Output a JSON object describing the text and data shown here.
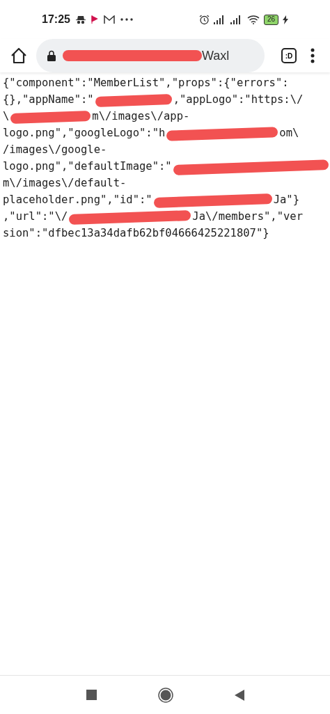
{
  "status_bar": {
    "time": "17:25",
    "battery": "26"
  },
  "address_bar": {
    "url": [
      {
        "kind": "redacted"
      },
      {
        "kind": "text",
        "text": "Waxl"
      }
    ]
  },
  "tab_count": ":D",
  "lines": [
    {
      "segments": [
        {
          "kind": "text",
          "text": "{\"component\":\"MemberList\",\"props\":{\"errors\":"
        }
      ]
    },
    {
      "segments": [
        {
          "kind": "text",
          "text": "{},\"appName\":\""
        },
        {
          "kind": "redacted"
        },
        {
          "kind": "text",
          "text": ",\"appLogo\":\"https:\\/"
        }
      ]
    },
    {
      "segments": [
        {
          "kind": "text",
          "text": "\\"
        },
        {
          "kind": "redacted"
        },
        {
          "kind": "text",
          "text": "m\\/images\\/app-"
        }
      ]
    },
    {
      "segments": [
        {
          "kind": "text",
          "text": "logo.png\",\"googleLogo\":\"h"
        },
        {
          "kind": "redacted"
        },
        {
          "kind": "text",
          "text": "om\\"
        }
      ]
    },
    {
      "segments": [
        {
          "kind": "text",
          "text": "/images\\/google-"
        }
      ]
    },
    {
      "segments": [
        {
          "kind": "text",
          "text": "logo.png\",\"defaultImage\":\""
        },
        {
          "kind": "redacted"
        }
      ]
    },
    {
      "segments": [
        {
          "kind": "text",
          "text": "m\\/images\\/default-"
        }
      ]
    },
    {
      "segments": [
        {
          "kind": "text",
          "text": "placeholder.png\",\"id\":\""
        },
        {
          "kind": "redacted"
        },
        {
          "kind": "text",
          "text": "Ja\"}"
        }
      ]
    },
    {
      "segments": [
        {
          "kind": "text",
          "text": ",\"url\":\"\\/"
        },
        {
          "kind": "redacted"
        },
        {
          "kind": "text",
          "text": "Ja\\/members\",\"ver"
        }
      ]
    },
    {
      "segments": [
        {
          "kind": "text",
          "text": "sion\":\"dfbec13a34dafb62bf04666425221807\"}"
        }
      ]
    }
  ]
}
